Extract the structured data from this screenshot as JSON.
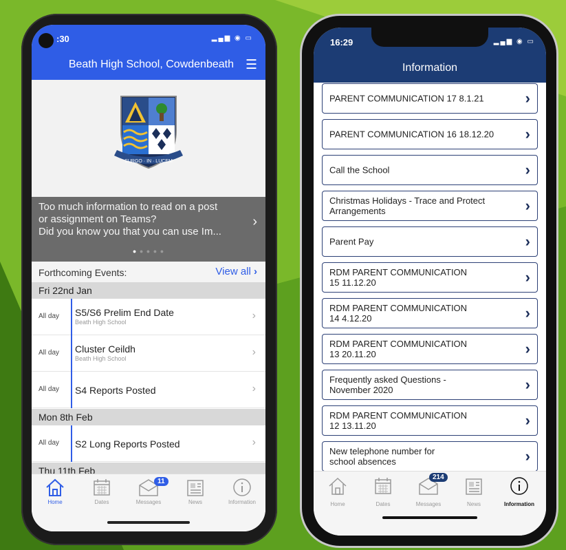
{
  "colors": {
    "background_green": "#5a9a1a",
    "header_blue": "#2f5de6",
    "header_navy": "#1c3c74"
  },
  "phone1": {
    "status": {
      "time": ":30",
      "icons": "signal-wifi-battery"
    },
    "header": {
      "title": "Beath High School, Cowdenbeath",
      "menu_icon": "list-menu-icon"
    },
    "crest": {
      "motto": "SURGO · IN · LUCEM"
    },
    "promo": {
      "line1": "Too much information to read on a post",
      "line2": "or assignment on Teams?",
      "line3": "Did you know you that you can use Im...",
      "dot_count": 5,
      "active_dot": 1
    },
    "forthcoming": {
      "label": "Forthcoming Events:",
      "view_all": "View all"
    },
    "day_headers": [
      "Fri 22nd Jan",
      "Mon 8th Feb",
      "Thu 11th Feb"
    ],
    "events": [
      {
        "time": "All day",
        "title": "S5/S6 Prelim End Date",
        "location": "Beath High School"
      },
      {
        "time": "All day",
        "title": "Cluster Ceildh",
        "location": "Beath High School"
      },
      {
        "time": "All day",
        "title": "S4 Reports Posted",
        "location": ""
      },
      {
        "time": "All day",
        "title": "S2 Long Reports Posted",
        "location": ""
      }
    ],
    "tabs": [
      {
        "label": "Home",
        "icon": "home-icon",
        "active": true
      },
      {
        "label": "Dates",
        "icon": "calendar-icon"
      },
      {
        "label": "Messages",
        "icon": "envelope-icon",
        "badge": "11"
      },
      {
        "label": "News",
        "icon": "newspaper-icon"
      },
      {
        "label": "Information",
        "icon": "info-icon"
      }
    ]
  },
  "phone2": {
    "status": {
      "time": "16:29",
      "icons": "signal-wifi-battery"
    },
    "header": {
      "title": "Information"
    },
    "items": [
      {
        "line1": "PARENT COMMUNICATION 17  8.1.21",
        "line2": ""
      },
      {
        "line1": "PARENT COMMUNICATION 16  18.12.20",
        "line2": ""
      },
      {
        "line1": "Call the School",
        "line2": ""
      },
      {
        "line1": "Christmas Holidays - Trace and Protect",
        "line2": "Arrangements"
      },
      {
        "line1": "Parent Pay",
        "line2": ""
      },
      {
        "line1": "RDM PARENT COMMUNICATION",
        "line2": "15  11.12.20"
      },
      {
        "line1": "RDM PARENT COMMUNICATION",
        "line2": "14    4.12.20"
      },
      {
        "line1": "RDM PARENT COMMUNICATION",
        "line2": "13 20.11.20"
      },
      {
        "line1": "Frequently asked Questions -",
        "line2": "November  2020"
      },
      {
        "line1": "RDM PARENT COMMUNICATION",
        "line2": "12 13.11.20"
      },
      {
        "line1": "New telephone number for",
        "line2": "school absences"
      }
    ],
    "tabs": [
      {
        "label": "Home",
        "icon": "home-icon"
      },
      {
        "label": "Dates",
        "icon": "calendar-icon"
      },
      {
        "label": "Messages",
        "icon": "envelope-icon",
        "badge": "214"
      },
      {
        "label": "News",
        "icon": "newspaper-icon"
      },
      {
        "label": "Information",
        "icon": "info-icon",
        "active": true
      }
    ]
  }
}
